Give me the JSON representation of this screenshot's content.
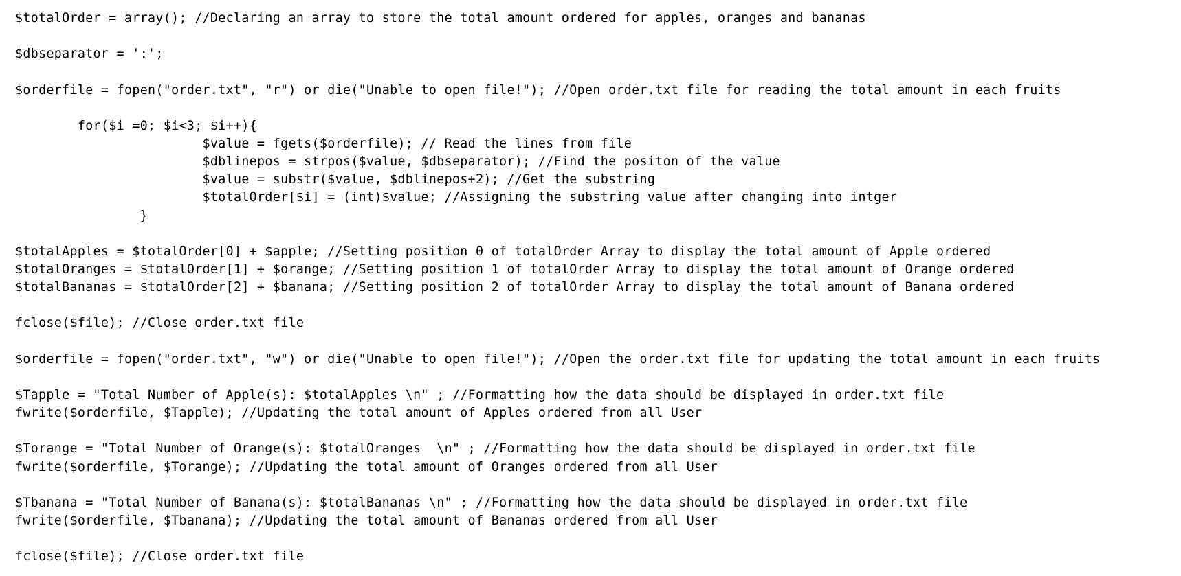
{
  "code": {
    "language": "php",
    "lines": [
      "$totalOrder = array(); //Declaring an array to store the total amount ordered for apples, oranges and bananas",
      "",
      "$dbseparator = ':';",
      "",
      "$orderfile = fopen(\"order.txt\", \"r\") or die(\"Unable to open file!\"); //Open order.txt file for reading the total amount in each fruits",
      "",
      "        for($i =0; $i<3; $i++){",
      "                        $value = fgets($orderfile); // Read the lines from file",
      "                        $dblinepos = strpos($value, $dbseparator); //Find the positon of the value",
      "                        $value = substr($value, $dblinepos+2); //Get the substring",
      "                        $totalOrder[$i] = (int)$value; //Assigning the substring value after changing into intger",
      "                }",
      "",
      "$totalApples = $totalOrder[0] + $apple; //Setting position 0 of totalOrder Array to display the total amount of Apple ordered",
      "$totalOranges = $totalOrder[1] + $orange; //Setting position 1 of totalOrder Array to display the total amount of Orange ordered",
      "$totalBananas = $totalOrder[2] + $banana; //Setting position 2 of totalOrder Array to display the total amount of Banana ordered",
      "",
      "fclose($file); //Close order.txt file",
      "",
      "$orderfile = fopen(\"order.txt\", \"w\") or die(\"Unable to open file!\"); //Open the order.txt file for updating the total amount in each fruits",
      "",
      "$Tapple = \"Total Number of Apple(s): $totalApples \\n\" ; //Formatting how the data should be displayed in order.txt file",
      "fwrite($orderfile, $Tapple); //Updating the total amount of Apples ordered from all User",
      "",
      "$Torange = \"Total Number of Orange(s): $totalOranges  \\n\" ; //Formatting how the data should be displayed in order.txt file",
      "fwrite($orderfile, $Torange); //Updating the total amount of Oranges ordered from all User",
      "",
      "$Tbanana = \"Total Number of Banana(s): $totalBananas \\n\" ; //Formatting how the data should be displayed in order.txt file",
      "fwrite($orderfile, $Tbanana); //Updating the total amount of Bananas ordered from all User",
      "",
      "fclose($file); //Close order.txt file"
    ]
  }
}
